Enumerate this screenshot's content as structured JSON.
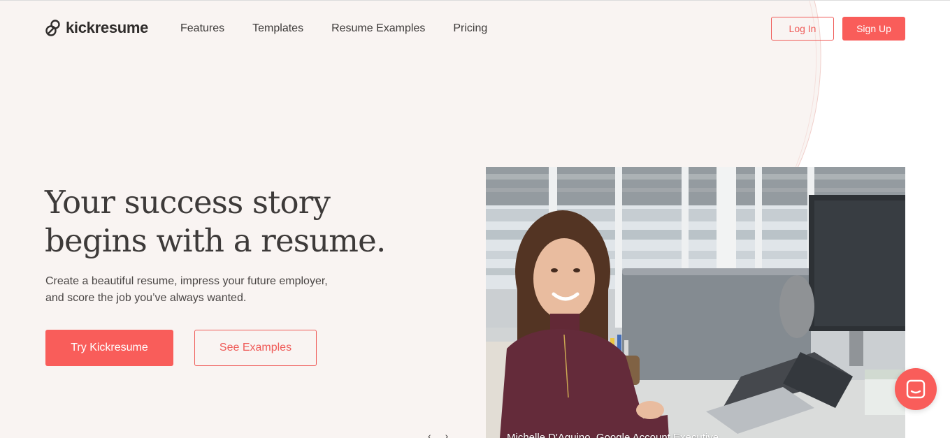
{
  "brand": {
    "name": "kickresume",
    "accent": "#f95d5a",
    "text_color": "#3d3a39",
    "background": "#f9f4f2"
  },
  "nav": {
    "items": [
      {
        "label": "Features"
      },
      {
        "label": "Templates"
      },
      {
        "label": "Resume Examples"
      },
      {
        "label": "Pricing"
      }
    ],
    "login_label": "Log In",
    "signup_label": "Sign Up"
  },
  "hero": {
    "title_line1": "Your success story",
    "title_line2": "begins with a resume.",
    "subtitle_line1": "Create a beautiful resume, impress your future employer,",
    "subtitle_line2": "and score the job you’ve always wanted.",
    "primary_cta": "Try Kickresume",
    "secondary_cta": "See Examples"
  },
  "carousel": {
    "prev_icon": "chevron-left-icon",
    "next_icon": "chevron-right-icon",
    "prev_glyph": "‹",
    "next_glyph": "›"
  },
  "photo": {
    "caption": "Michelle D'Aquino, Google Account Executive"
  },
  "chat": {
    "icon": "chat-icon"
  }
}
